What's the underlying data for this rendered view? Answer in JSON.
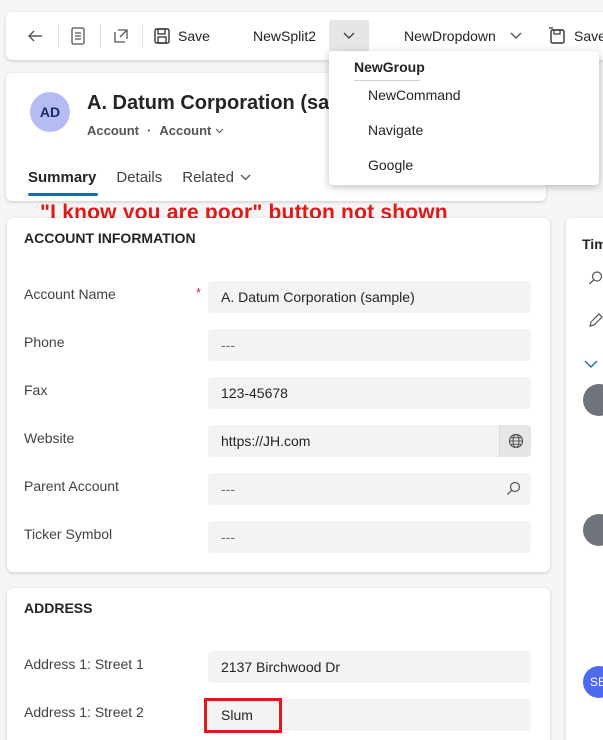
{
  "commandbar": {
    "back_icon": "back-arrow-icon",
    "save_label": "Save",
    "split_label": "NewSplit2",
    "dropdown_label": "NewDropdown",
    "save2_label": "Save"
  },
  "flyout": {
    "group_label": "NewGroup",
    "items": [
      "NewCommand",
      "Navigate",
      "Google"
    ]
  },
  "header": {
    "avatar_initials": "AD",
    "title": "A. Datum Corporation (sam",
    "entity": "Account",
    "form_selector": "Account",
    "tabs": [
      "Summary",
      "Details",
      "Related"
    ]
  },
  "annotation": "\"I know you are poor\" button not shown",
  "account_info": {
    "title": "ACCOUNT INFORMATION",
    "fields": [
      {
        "label": "Account Name",
        "value": "A. Datum Corporation (sample)",
        "required": "*"
      },
      {
        "label": "Phone",
        "value": "---"
      },
      {
        "label": "Fax",
        "value": "123-45678"
      },
      {
        "label": "Website",
        "value": "https://JH.com"
      },
      {
        "label": "Parent Account",
        "value": "---"
      },
      {
        "label": "Ticker Symbol",
        "value": "---"
      }
    ]
  },
  "address": {
    "title": "ADDRESS",
    "fields": [
      {
        "label": "Address 1: Street 1",
        "value": "2137 Birchwood Dr"
      },
      {
        "label": "Address 1: Street 2",
        "value": "Slum"
      }
    ]
  },
  "timeline": {
    "title": "Tim",
    "avatar_initials": "SE"
  },
  "colors": {
    "accent": "#0f6cbd",
    "annotation_red": "#e01818",
    "avatar_bg": "#b4bcf2"
  }
}
